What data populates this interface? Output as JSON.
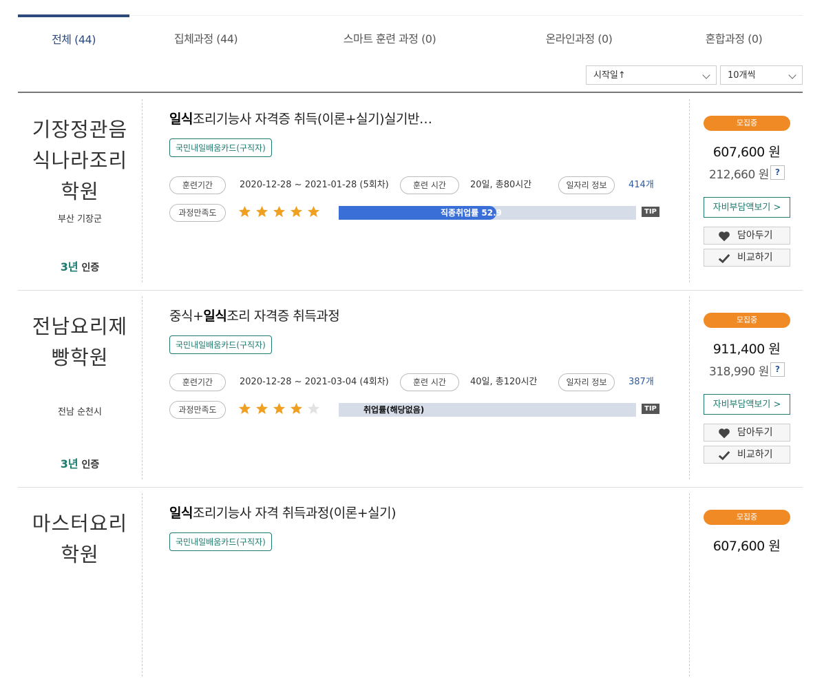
{
  "tabs": [
    {
      "label": "전체 (44)"
    },
    {
      "label": "집체과정 (44)"
    },
    {
      "label": "스마트 훈련 과정 (0)"
    },
    {
      "label": "온라인과정 (0)"
    },
    {
      "label": "혼합과정 (0)"
    }
  ],
  "sort": {
    "selected": "시작일↑"
  },
  "page_size": {
    "selected": "10개씩"
  },
  "labels": {
    "period": "훈련기간",
    "hours": "훈련 시간",
    "jobs": "일자리 정보",
    "satisfaction": "과정만족도",
    "tip": "TIP",
    "recruiting": "모집중",
    "self_pay": "자비부담액보기 >",
    "save": "담아두기",
    "compare": "비교하기",
    "q": "?",
    "card_badge": "국민내일배움카드(구직자)",
    "cert_years": "3년",
    "cert_label": "인증"
  },
  "colors": {
    "accent": "#2c4a7c",
    "teal": "#1c7a6e",
    "orange": "#f08a24",
    "bar_fill": "#3a6fd8",
    "star": "#f0a020"
  },
  "courses": [
    {
      "inst_name": "기장정관음식나라조리학원",
      "location": "부산 기장군",
      "title_bold": "일식",
      "title_pre": "",
      "title_post": "조리기능사 자격증 취득(이론+실기)실기반…",
      "period": "2020-12-28 ~ 2021-01-28 (5회차)",
      "hours": "20일, 총80시간",
      "jobs_count": "414개",
      "rating": 5,
      "employment_label": "직종취업률 52.9",
      "employment_rate": 52.9,
      "price": "607,600 원",
      "self_price": "212,660 원"
    },
    {
      "inst_name": "전남요리제빵학원",
      "location": "전남 순천시",
      "title_pre": "중식+",
      "title_bold": "일식",
      "title_post": "조리 자격증 취득과정",
      "period": "2020-12-28 ~ 2021-03-04 (4회차)",
      "hours": "40일, 총120시간",
      "jobs_count": "387개",
      "rating": 4,
      "employment_label": "취업률(해당없음)",
      "employment_rate": 0,
      "price": "911,400 원",
      "self_price": "318,990 원"
    },
    {
      "inst_name": "마스터요리학원",
      "title_pre": "",
      "title_bold": "일식",
      "title_post": "조리기능사 자격 취득과정(이론+실기)",
      "price": "607,600 원"
    }
  ]
}
